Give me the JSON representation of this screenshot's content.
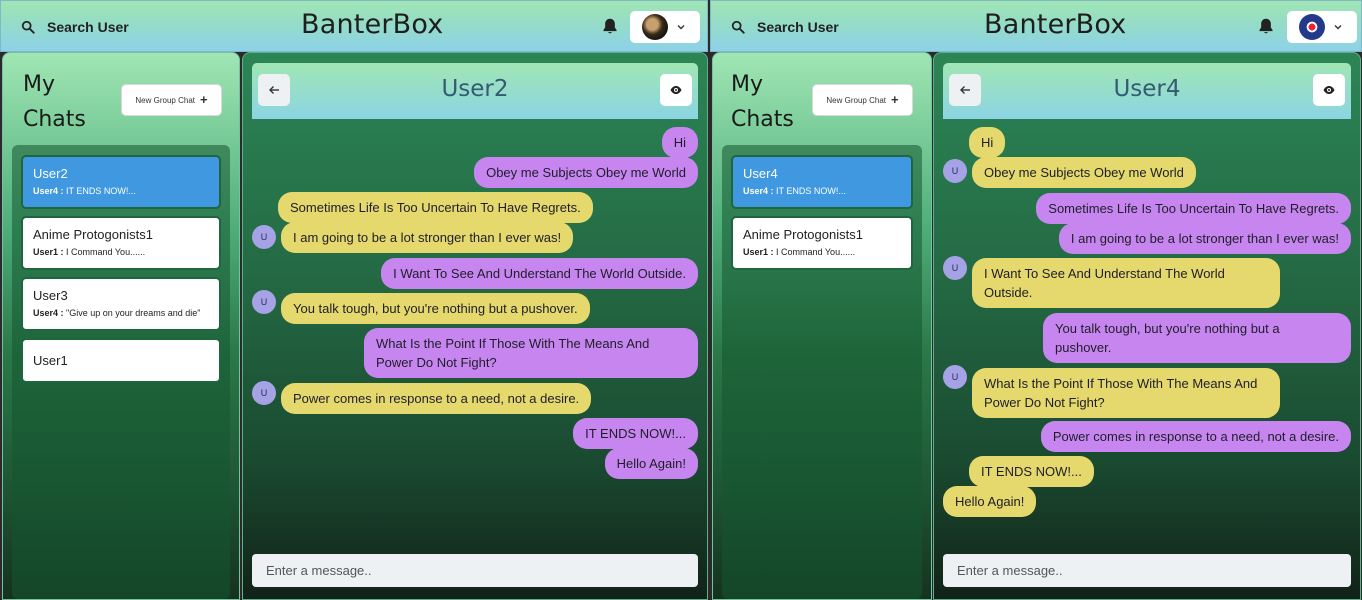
{
  "panels": [
    {
      "header": {
        "search_label": "Search User",
        "brand": "BanterBox"
      },
      "sidebar": {
        "title_line1": "My",
        "title_line2": "Chats",
        "new_group_label": "New Group Chat",
        "chats": [
          {
            "name": "User2",
            "sender": "User4 :",
            "latest": "IT ENDS NOW!...",
            "active": true
          },
          {
            "name": "Anime Protogonists1",
            "sender": "User1 :",
            "latest": "I Command You......",
            "active": false
          },
          {
            "name": "User3",
            "sender": "User4 :",
            "latest": "\"Give up on your dreams and die\"",
            "active": false
          },
          {
            "name": "User1",
            "sender": "",
            "latest": "",
            "active": false
          }
        ]
      },
      "chat": {
        "title": "User2",
        "avatar_initial": "U",
        "placeholder": "Enter a message..",
        "messages": [
          {
            "text": "Hi",
            "side": "me"
          },
          {
            "text": "Obey me Subjects Obey me World",
            "side": "me"
          },
          {
            "text": "Sometimes Life Is Too Uncertain To Have Regrets.",
            "side": "them"
          },
          {
            "text": "I am going to be a lot stronger than I ever was!",
            "side": "them"
          },
          {
            "text": "I Want To See And Understand The World Outside.",
            "side": "me"
          },
          {
            "text": "You talk tough, but you're nothing but a pushover.",
            "side": "them"
          },
          {
            "text": "What Is the Point If Those With The Means And Power Do Not Fight?",
            "side": "me"
          },
          {
            "text": "Power comes in response to a need, not a desire.",
            "side": "them"
          },
          {
            "text": "IT ENDS NOW!...",
            "side": "me"
          },
          {
            "text": "Hello Again!",
            "side": "me"
          }
        ]
      }
    },
    {
      "header": {
        "search_label": "Search User",
        "brand": "BanterBox"
      },
      "sidebar": {
        "title_line1": "My",
        "title_line2": "Chats",
        "new_group_label": "New Group Chat",
        "chats": [
          {
            "name": "User4",
            "sender": "User4 :",
            "latest": "IT ENDS NOW!...",
            "active": true
          },
          {
            "name": "Anime Protogonists1",
            "sender": "User1 :",
            "latest": "I Command You......",
            "active": false
          }
        ]
      },
      "chat": {
        "title": "User4",
        "avatar_initial": "U",
        "placeholder": "Enter a message..",
        "messages": [
          {
            "text": "Hi",
            "side": "them"
          },
          {
            "text": "Obey me Subjects Obey me World",
            "side": "them"
          },
          {
            "text": "Sometimes Life Is Too Uncertain To Have Regrets.",
            "side": "me"
          },
          {
            "text": "I am going to be a lot stronger than I ever was!",
            "side": "me"
          },
          {
            "text": "I Want To See And Understand The World Outside.",
            "side": "them"
          },
          {
            "text": "You talk tough, but you're nothing but a pushover.",
            "side": "me"
          },
          {
            "text": "What Is the Point If Those With The Means And Power Do Not Fight?",
            "side": "them"
          },
          {
            "text": "Power comes in response to a need, not a desire.",
            "side": "me"
          },
          {
            "text": "IT ENDS NOW!...",
            "side": "them"
          },
          {
            "text": "Hello Again!",
            "side": "them"
          }
        ]
      }
    }
  ]
}
